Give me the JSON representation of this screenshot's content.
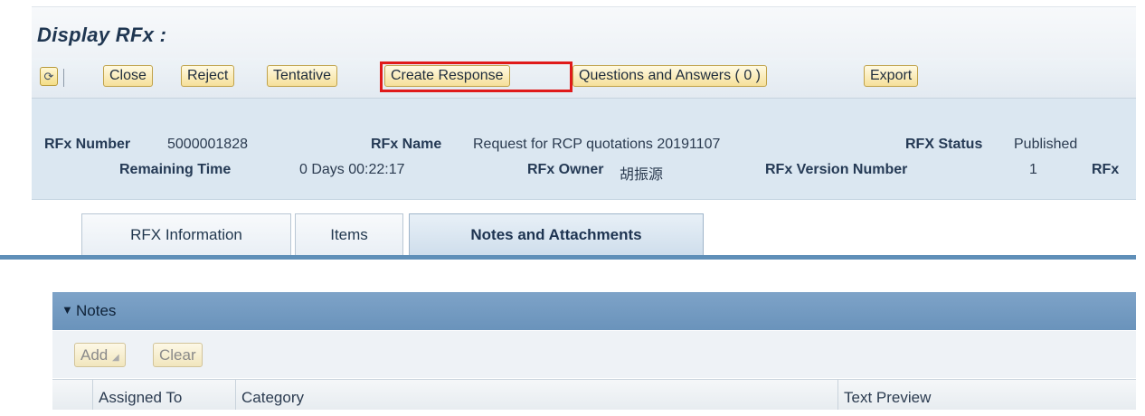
{
  "title": "Display RFx :",
  "toolbar": {
    "refresh_icon": "refresh-icon",
    "buttons": [
      "Close",
      "Reject",
      "Tentative",
      "Create Response",
      "Questions and Answers ( 0 )",
      "Export"
    ]
  },
  "header": {
    "rfx_number_label": "RFx Number",
    "rfx_number": "5000001828",
    "rfx_name_label": "RFx Name",
    "rfx_name": "Request for RCP quotations 20191107",
    "rfx_status_label": "RFX Status",
    "rfx_status": "Published",
    "remaining_time_label": "Remaining Time",
    "remaining_time": "0 Days 00:22:17",
    "rfx_owner_label": "RFx Owner",
    "rfx_owner": "胡振源",
    "rfx_version_label": "RFx Version Number",
    "rfx_version": "1",
    "rfx_truncated_label": "RFx"
  },
  "tabs": [
    "RFX Information",
    "Items",
    "Notes and Attachments"
  ],
  "notes": {
    "title": "Notes",
    "add_label": "Add",
    "clear_label": "Clear",
    "columns": [
      "Assigned To",
      "Category",
      "Text Preview"
    ]
  },
  "colors": {
    "highlight": "#e01a1a",
    "header_bg": "#dbe7f1",
    "section_bar": "#6a93bb",
    "button_fill": "#f6e09a"
  }
}
